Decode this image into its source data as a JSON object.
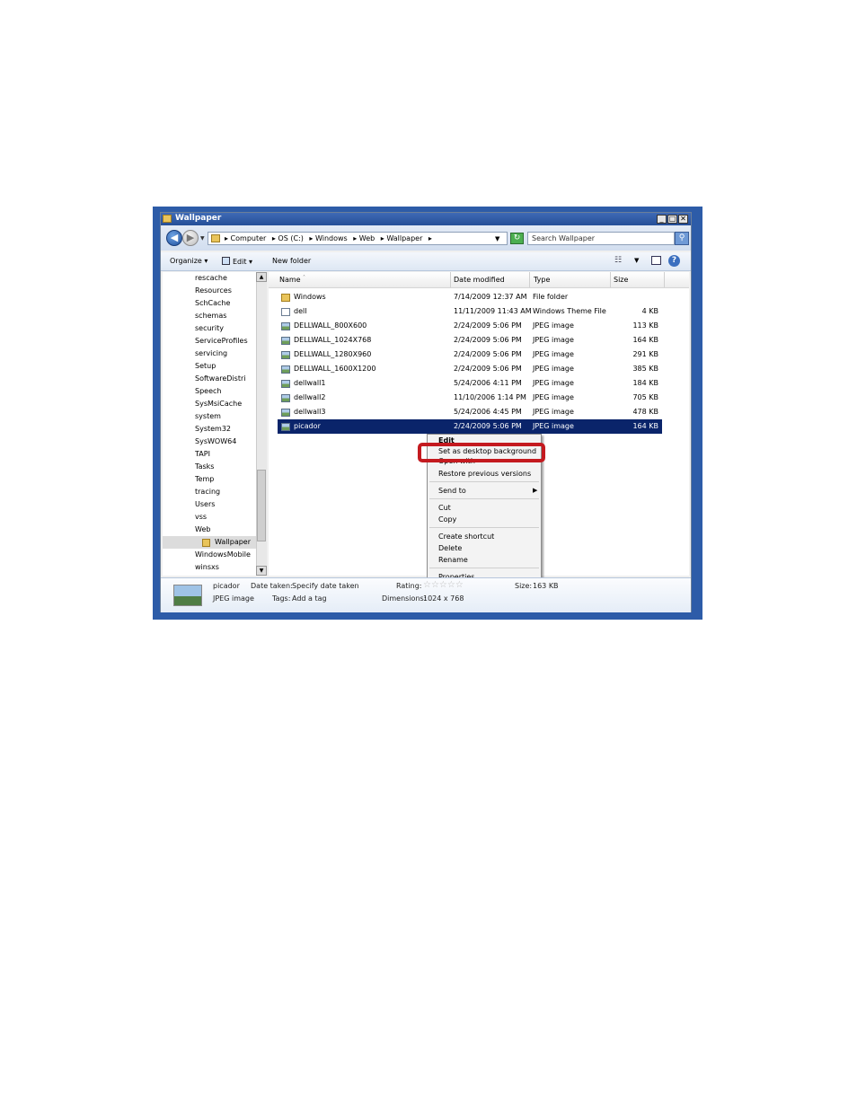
{
  "window": {
    "title": "Wallpaper",
    "minimize_glyph": "_",
    "maximize_glyph": "□",
    "close_glyph": "✕"
  },
  "address": {
    "crumbs": [
      "▸ Computer",
      "▸ OS (C:)",
      "▸ Windows",
      "▸ Web",
      "▸ Wallpaper",
      "▸"
    ],
    "search_placeholder": "Search Wallpaper"
  },
  "toolbar": {
    "organize": "Organize ▾",
    "edit": "Edit ▾",
    "new_folder": "New folder"
  },
  "tree": {
    "items": [
      "rescache",
      "Resources",
      "SchCache",
      "schemas",
      "security",
      "ServiceProfiles",
      "servicing",
      "Setup",
      "SoftwareDistri",
      "Speech",
      "SysMsiCache",
      "system",
      "System32",
      "SysWOW64",
      "TAPI",
      "Tasks",
      "Temp",
      "tracing",
      "Users",
      "vss",
      "Web",
      "Wallpaper",
      "WindowsMobile",
      "winsxs"
    ],
    "selected": "Wallpaper"
  },
  "columns": {
    "name": "Name",
    "date": "Date modified",
    "type": "Type",
    "size": "Size"
  },
  "files": [
    {
      "name": "Windows",
      "date": "7/14/2009 12:37 AM",
      "type": "File folder",
      "size": "",
      "icon": "folder-icon"
    },
    {
      "name": "dell",
      "date": "11/11/2009 11:43 AM",
      "type": "Windows Theme File",
      "size": "4 KB",
      "icon": "theme-file-icon"
    },
    {
      "name": "DELLWALL_800X600",
      "date": "2/24/2009 5:06 PM",
      "type": "JPEG image",
      "size": "113 KB",
      "icon": "image-file-icon"
    },
    {
      "name": "DELLWALL_1024X768",
      "date": "2/24/2009 5:06 PM",
      "type": "JPEG image",
      "size": "164 KB",
      "icon": "image-file-icon"
    },
    {
      "name": "DELLWALL_1280X960",
      "date": "2/24/2009 5:06 PM",
      "type": "JPEG image",
      "size": "291 KB",
      "icon": "image-file-icon"
    },
    {
      "name": "DELLWALL_1600X1200",
      "date": "2/24/2009 5:06 PM",
      "type": "JPEG image",
      "size": "385 KB",
      "icon": "image-file-icon"
    },
    {
      "name": "dellwall1",
      "date": "5/24/2006 4:11 PM",
      "type": "JPEG image",
      "size": "184 KB",
      "icon": "image-file-icon"
    },
    {
      "name": "dellwall2",
      "date": "11/10/2006 1:14 PM",
      "type": "JPEG image",
      "size": "705 KB",
      "icon": "image-file-icon"
    },
    {
      "name": "dellwall3",
      "date": "5/24/2006 4:45 PM",
      "type": "JPEG image",
      "size": "478 KB",
      "icon": "image-file-icon"
    },
    {
      "name": "picador",
      "date": "2/24/2009 5:06 PM",
      "type": "JPEG image",
      "size": "164 KB",
      "icon": "image-file-icon"
    }
  ],
  "selected_file": "picador",
  "context_menu": {
    "edit": "Edit",
    "set_background": "Set as desktop background",
    "open_with": "Open with",
    "restore": "Restore previous versions",
    "send_to": "Send to",
    "cut": "Cut",
    "copy": "Copy",
    "create_shortcut": "Create shortcut",
    "delete": "Delete",
    "rename": "Rename",
    "properties": "Properties"
  },
  "highlight_color": "#c41a1f",
  "details": {
    "name": "picador",
    "filetype": "JPEG image",
    "date_taken_label": "Date taken:",
    "date_taken_value": "Specify date taken",
    "tags_label": "Tags:",
    "tags_value": "Add a tag",
    "rating_label": "Rating:",
    "dimensions_label": "Dimensions:",
    "dimensions_value": "1024 x 768",
    "size_label": "Size:",
    "size_value": "163 KB"
  }
}
